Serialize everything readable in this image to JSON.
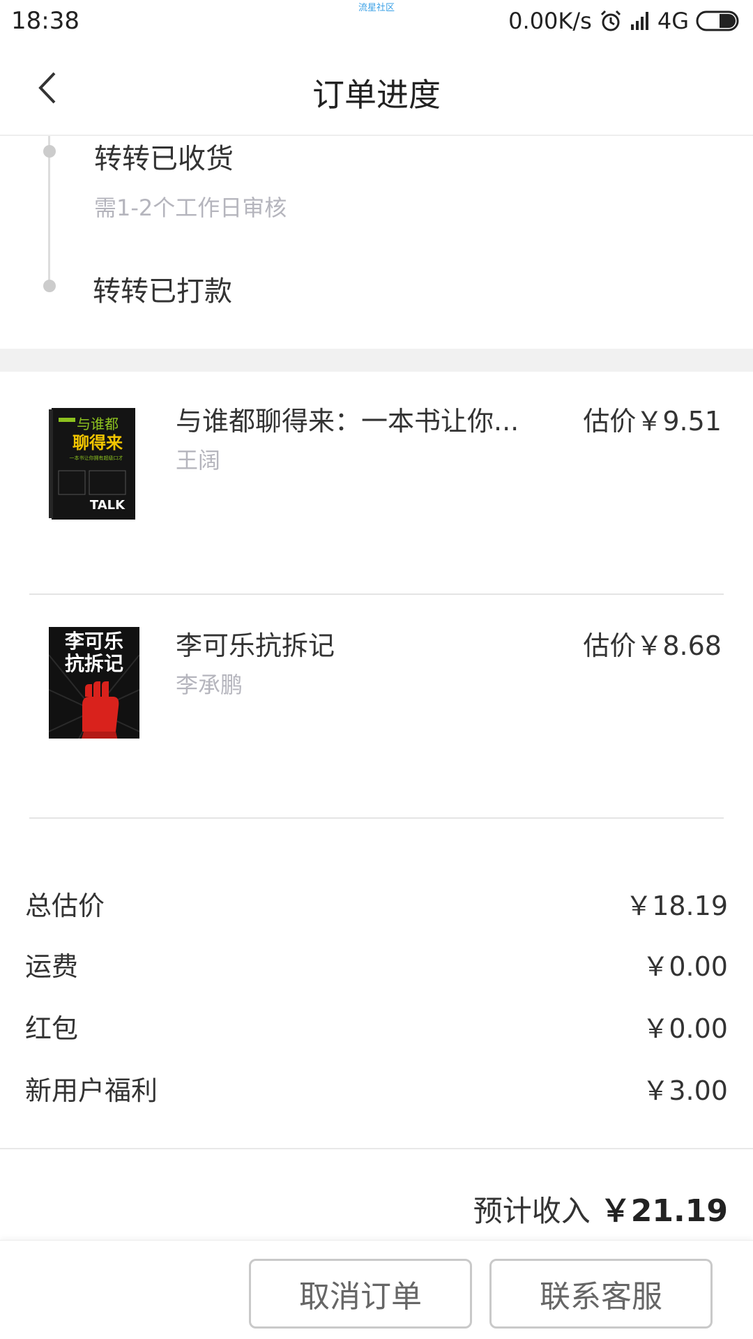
{
  "status_bar": {
    "time": "18:38",
    "center_text": "流星社区",
    "network_speed": "0.00K/s",
    "network_type": "4G"
  },
  "nav": {
    "title": "订单进度"
  },
  "timeline": [
    {
      "title": "转转已收货",
      "subtitle": "需1-2个工作日审核"
    },
    {
      "title": "转转已打款",
      "subtitle": ""
    }
  ],
  "books": [
    {
      "title": "与谁都聊得来：一本书让你...",
      "author": "王阔",
      "price": "估价￥9.51",
      "cover": {
        "top_text": "与谁都",
        "main_text": "聊得来",
        "tagline": "一本书让你拥有超级口才",
        "word": "TALK",
        "bg_color": "#141414",
        "accent_color": "#f2c500",
        "green_color": "#8dc21f"
      }
    },
    {
      "title": "李可乐抗拆记",
      "author": "李承鹏",
      "price": "估价￥8.68",
      "cover": {
        "line1": "李可乐",
        "line2": "抗拆记",
        "bg_color": "#111111",
        "accent_color": "#d9221c"
      }
    }
  ],
  "summary": [
    {
      "label": "总估价",
      "value": "￥18.19"
    },
    {
      "label": "运费",
      "value": "￥0.00"
    },
    {
      "label": "红包",
      "value": "￥0.00"
    },
    {
      "label": "新用户福利",
      "value": "￥3.00"
    }
  ],
  "income": {
    "label": "预计收入",
    "value": "￥21.19"
  },
  "actions": {
    "cancel_label": "取消订单",
    "contact_label": "联系客服"
  }
}
